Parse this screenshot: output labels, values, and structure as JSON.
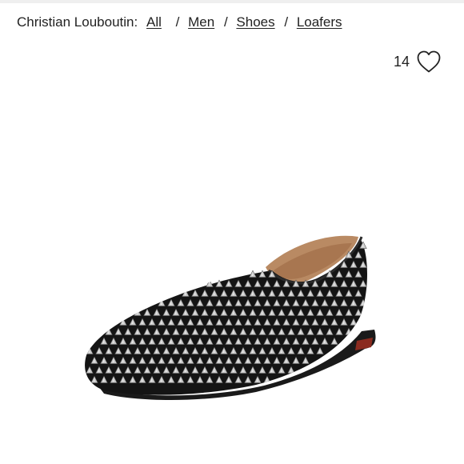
{
  "breadcrumb": {
    "brand": "Christian Louboutin:",
    "links": [
      "All",
      "Men",
      "Shoes",
      "Loafers"
    ],
    "separator": "/"
  },
  "favorites": {
    "count": "14",
    "icon": "heart-outline-icon"
  },
  "product_image": {
    "icon": "spiked-loafer-image",
    "colors": {
      "upper": "#141414",
      "lining": "#b98a63",
      "sole": "#8b2b1f",
      "studs": "#c9c9c9"
    }
  }
}
